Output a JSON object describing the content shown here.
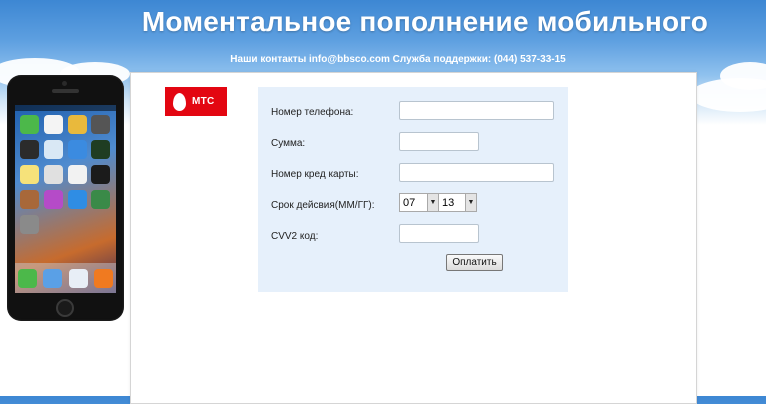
{
  "header": {
    "title": "Моментальное пополнение мобильного",
    "contacts": "Наши контакты info@bbsco.com Служба поддержки: (044) 537-33-15"
  },
  "operator_logo": {
    "text": "МТС",
    "color": "#e30611"
  },
  "form": {
    "phone_label": "Номер телефона:",
    "phone_value": "",
    "amount_label": "Сумма:",
    "amount_value": "",
    "card_label": "Номер кред карты:",
    "card_value": "",
    "expiry_label": "Срок дейсвия(ММ/ГГ):",
    "expiry_month": "07",
    "expiry_year": "13",
    "cvv_label": "CVV2 код:",
    "cvv_value": "",
    "submit_label": "Оплатить"
  },
  "colors": {
    "sky_top": "#3d87d3",
    "form_background": "#e6f0fb",
    "brand_red": "#e30611"
  }
}
